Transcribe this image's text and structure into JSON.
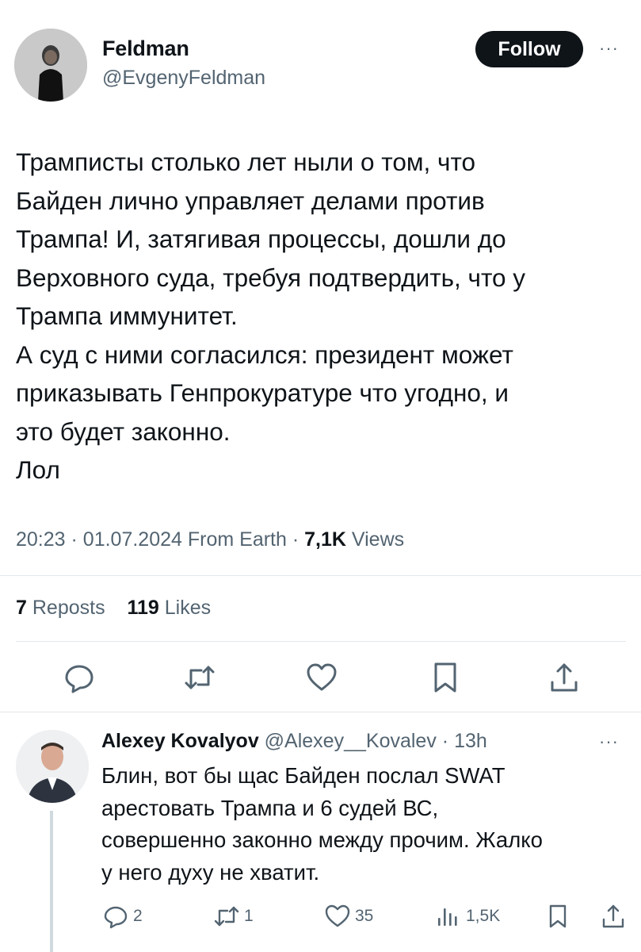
{
  "tweet": {
    "author_name": "Feldman",
    "author_handle": "@EvgenyFeldman",
    "follow_label": "Follow",
    "more_label": "···",
    "text": "Трамписты столько лет ныли о том, что\nБайден лично управляет делами против\nТрампа! И, затягивая процессы, дошли до\nВерховного суда, требуя подтвердить, что у\nТрампа иммунитет.\nА суд с ними согласился: президент может\nприказывать Генпрокуратуре что угодно, и\nэто будет законно.\nЛол",
    "time": "20:23",
    "date": "01.07.2024",
    "source": "From Earth",
    "views_count": "7,1K",
    "views_label": "Views",
    "reposts_count": "7",
    "reposts_label": "Reposts",
    "likes_count": "119",
    "likes_label": "Likes",
    "actions": [
      "reply-icon",
      "repost-icon",
      "like-icon",
      "bookmark-icon",
      "share-icon"
    ]
  },
  "reply": {
    "author_name": "Alexey Kovalyov",
    "author_handle": "@Alexey__Kovalev",
    "time_ago": "13h",
    "more_label": "···",
    "text": "Блин, вот бы щас Байден послал SWAT\nарестовать Трампа и 6 судей ВС,\nсовершенно законно между прочим. Жалко\nу него духу не хватит.",
    "replies_count": "2",
    "reposts_count": "1",
    "likes_count": "35",
    "views_count": "1,5K"
  },
  "colors": {
    "text_primary": "#0f1419",
    "text_secondary": "#536471",
    "button_bg": "#0f1419",
    "separator": "#e4e8eb",
    "thread_line": "#cfd9de"
  }
}
